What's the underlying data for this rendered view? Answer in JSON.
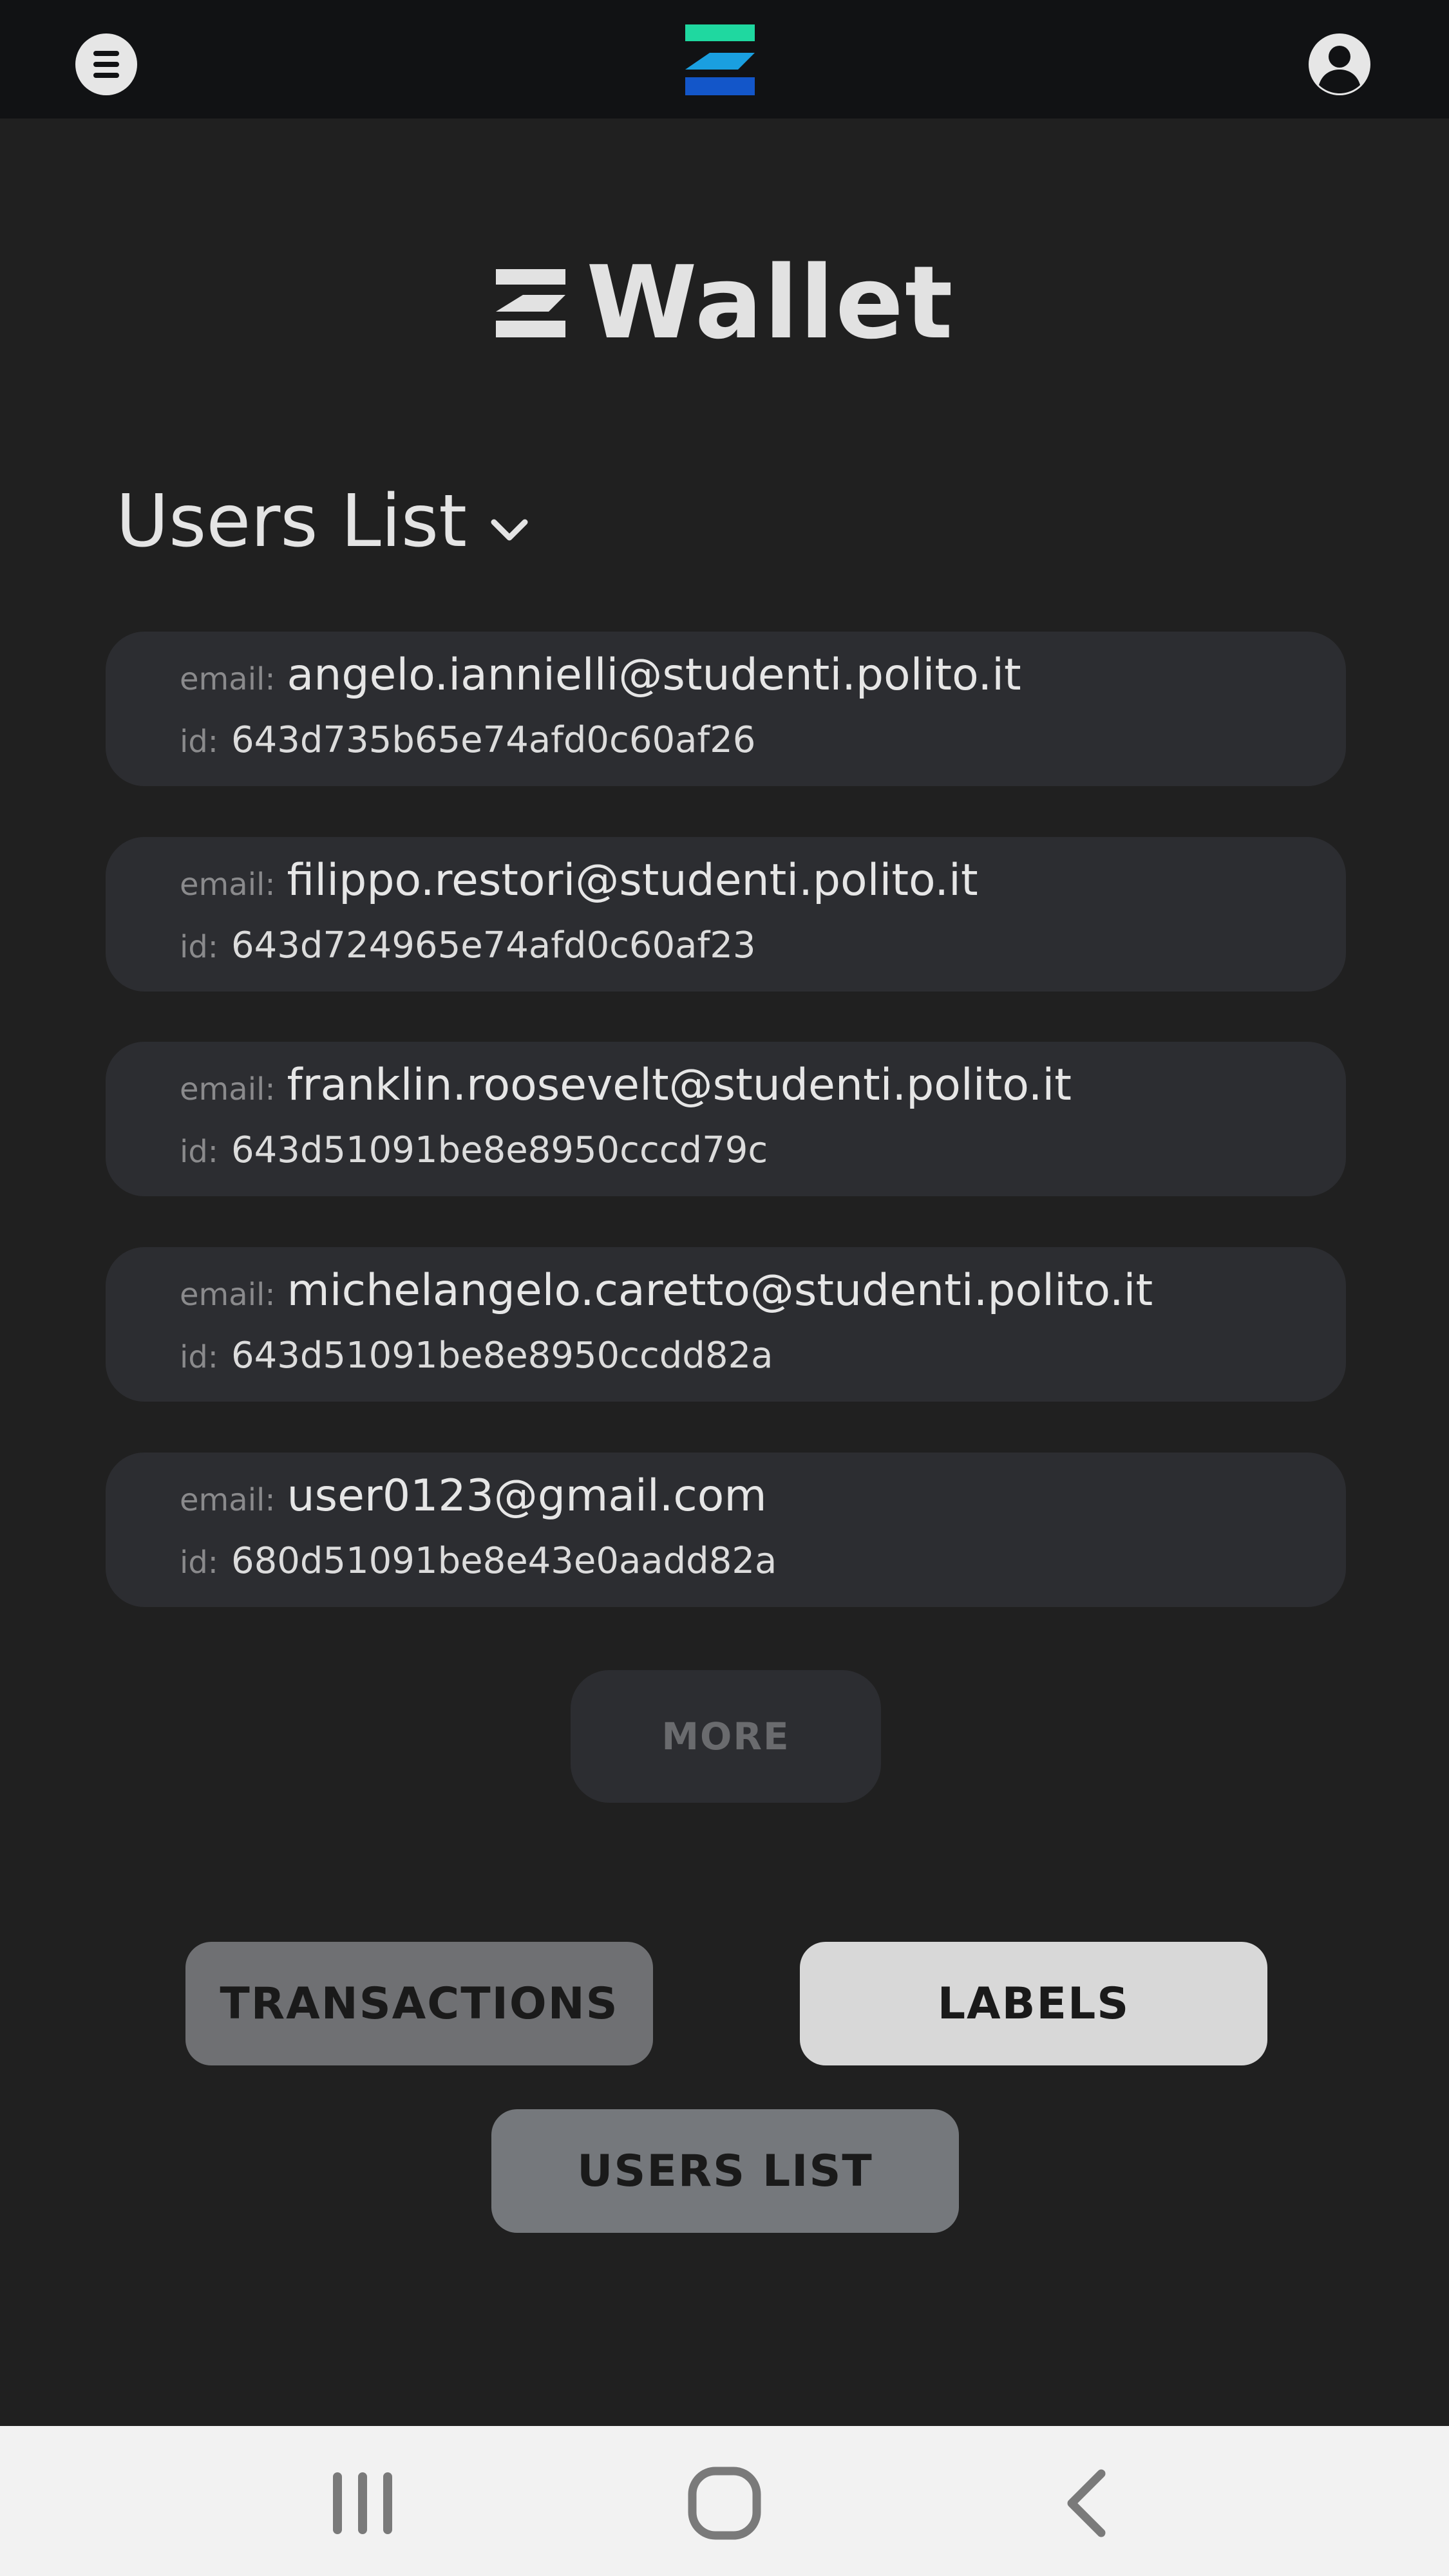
{
  "header": {
    "menu_icon": "menu-icon",
    "logo_icon": "z-logo-icon",
    "account_icon": "account-icon"
  },
  "brand": {
    "name": "Wallet",
    "colors": {
      "logo_top": "#1fd8a0",
      "logo_mid": "#1a9fe0",
      "logo_bottom": "#1356c9"
    }
  },
  "section": {
    "title": "Users List"
  },
  "labels": {
    "email": "email:",
    "id": "id:"
  },
  "users": [
    {
      "email": "angelo.iannielli@studenti.polito.it",
      "id": "643d735b65e74afd0c60af26"
    },
    {
      "email": "filippo.restori@studenti.polito.it",
      "id": "643d724965e74afd0c60af23"
    },
    {
      "email": "franklin.roosevelt@studenti.polito.it",
      "id": "643d51091be8e8950cccd79c"
    },
    {
      "email": "michelangelo.caretto@studenti.polito.it",
      "id": "643d51091be8e8950ccdd82a"
    },
    {
      "email": "user0123@gmail.com",
      "id": "680d51091be8e43e0aadd82a"
    }
  ],
  "more_label": "MORE",
  "nav": {
    "transactions": "TRANSACTIONS",
    "labels": "LABELS",
    "users_list": "USERS LIST"
  },
  "system_nav": {
    "recent_icon": "recent-apps-icon",
    "home_icon": "home-icon",
    "back_icon": "back-icon"
  }
}
